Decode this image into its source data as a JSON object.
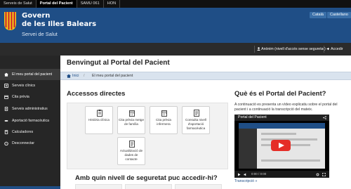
{
  "top_links": [
    "Serveis de Salut",
    "Portal del Pacient",
    "SAMU 061",
    "HON"
  ],
  "header": {
    "line1": "Govern",
    "line2": "de les Illes Balears",
    "line3": "Servei de Salut",
    "languages": [
      "Català",
      "Castellano"
    ]
  },
  "userbar": {
    "user": "Anònim (nivell d'accés sense seguretat)",
    "login": "Accedir"
  },
  "sidebar": {
    "items": [
      {
        "label": "El meu portal del pacient",
        "icon": "home-icon"
      },
      {
        "label": "Serveis clínics",
        "icon": "clinic-icon"
      },
      {
        "label": "Cita prèvia",
        "icon": "calendar-icon"
      },
      {
        "label": "Serveis administratius",
        "icon": "document-icon"
      },
      {
        "label": "Aportació farmacèutica",
        "icon": "pharmacy-icon"
      },
      {
        "label": "Calculadores",
        "icon": "calculator-icon"
      },
      {
        "label": "Desconnectar",
        "icon": "power-icon"
      }
    ]
  },
  "main": {
    "title": "Benvingut al Portal del Pacient",
    "breadcrumb": [
      "Inici",
      "El meu portal del pacient"
    ],
    "accessos_title": "Accessos directes",
    "tiles": [
      {
        "label": "Història clínica"
      },
      {
        "label": "Cita prèvia metge de família"
      },
      {
        "label": "Cita prèvia infermera"
      },
      {
        "label": "Consulta nivell d'aportació farmacèutica"
      },
      {
        "label": "Actualització de dades de contacte"
      }
    ],
    "security_title": "Amb quin nivell de seguretat puc accedir-hi?",
    "que_title": "Què és el Portal del Pacient?",
    "que_text": "A continuació es presenta un vídeo explicatiu sobre el portal del pacient i a continuació la transcripció del mateix.",
    "video_title": "Portal del Pacient",
    "video_time": "0:00 / 0:00",
    "video_link": "Transcripció »"
  },
  "colors": {
    "brand_blue": "#1f4e86",
    "sidebar_dark": "#262626",
    "play_red": "#e52d27"
  }
}
